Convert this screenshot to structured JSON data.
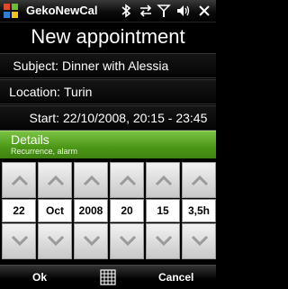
{
  "statusbar": {
    "app_title": "GekoNewCal",
    "icons": [
      "start-logo",
      "bluetooth-icon",
      "data-sync-icon",
      "signal-icon",
      "volume-icon",
      "close-icon"
    ]
  },
  "page": {
    "title": "New appointment"
  },
  "fields": {
    "subject": {
      "label": "Subject:",
      "value": "Dinner with Alessia"
    },
    "location": {
      "label": "Location:",
      "value": "Turin"
    },
    "start": {
      "label": "Start:",
      "value": "22/10/2008, 20:15 - 23:45"
    }
  },
  "details": {
    "title": "Details",
    "subtitle": "Recurrence, alarm"
  },
  "spinners": [
    {
      "value": "22"
    },
    {
      "value": "Oct"
    },
    {
      "value": "2008"
    },
    {
      "value": "20"
    },
    {
      "value": "15"
    },
    {
      "value": "3,5h"
    }
  ],
  "softkeys": {
    "left": "Ok",
    "right": "Cancel",
    "center_icon": "keyboard-icon"
  },
  "colors": {
    "accent_green": "#4b9616"
  }
}
